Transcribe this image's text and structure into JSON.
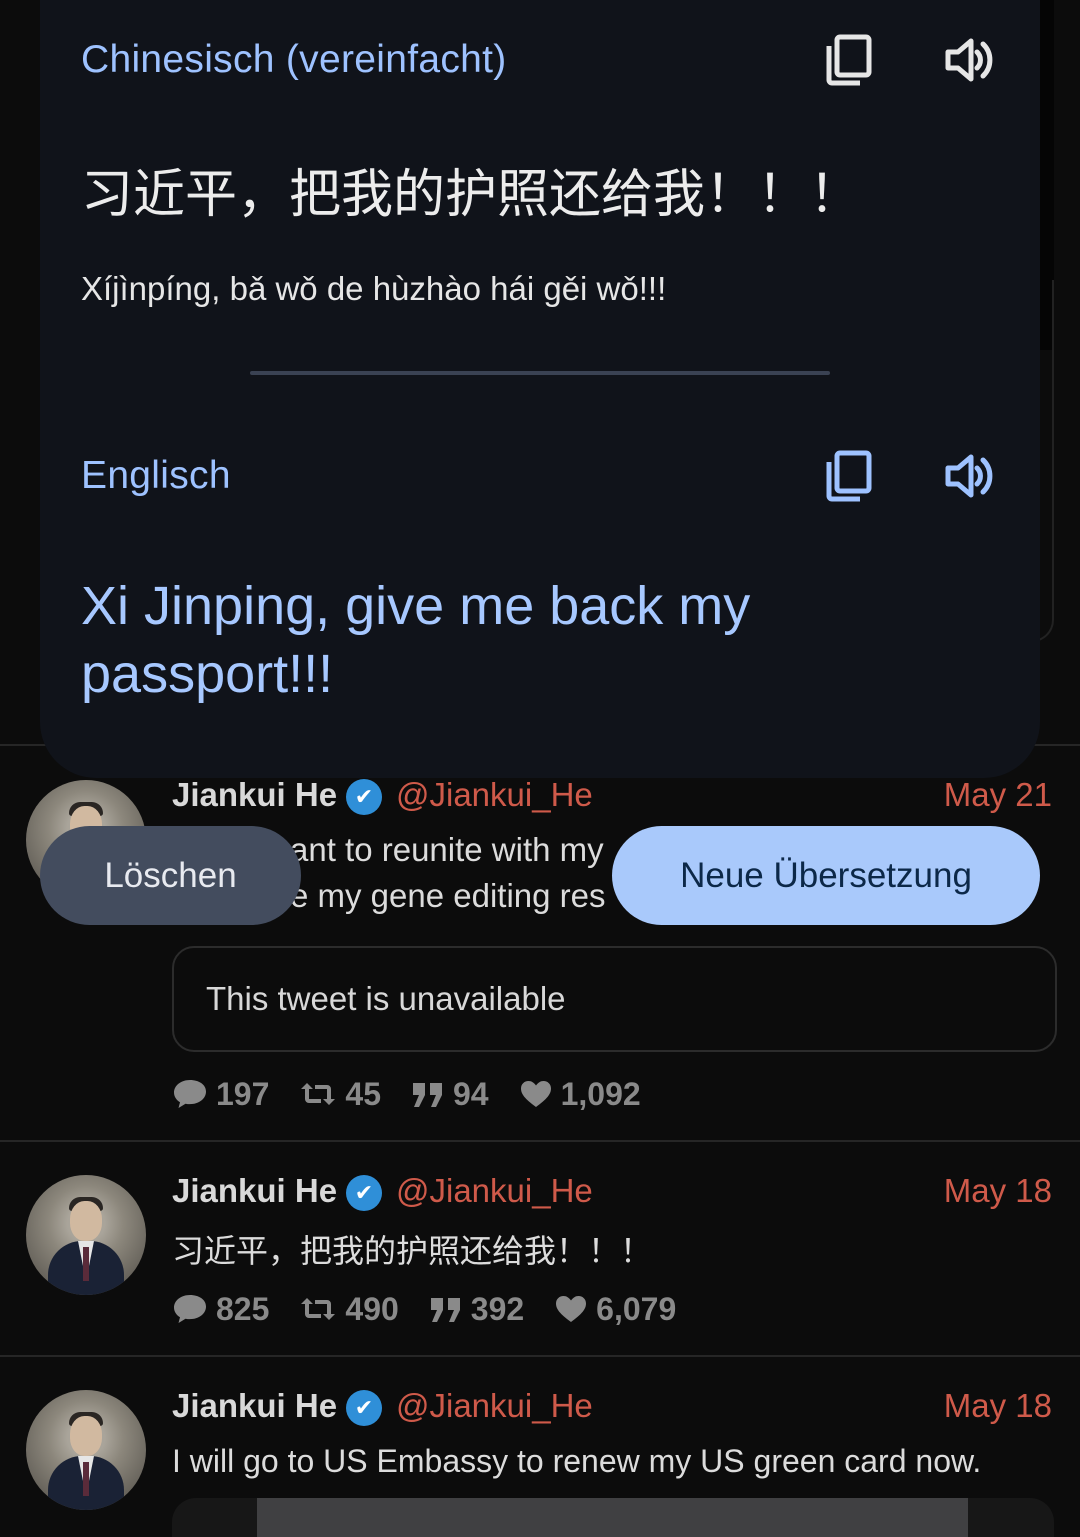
{
  "translation": {
    "source_lang": "Chinesisch (vereinfacht)",
    "source_text": "习近平，把我的护照还给我！！！",
    "pinyin": "Xíjìnpíng, bǎ wǒ de hùzhào hái gěi wǒ!!!",
    "target_lang": "Englisch",
    "target_text": "Xi Jinping, give me back my passport!!!",
    "icons": [
      "copy-icon",
      "speaker-icon"
    ]
  },
  "actions": {
    "delete_label": "Löschen",
    "new_translation_label": "Neue Übersetzung"
  },
  "tweets": [
    {
      "name": "Jiankui He",
      "handle": "@Jiankui_He",
      "date": "May 21",
      "text_line1": "ant to reunite with my",
      "text_line2": "e my gene editing res",
      "quoted": "This tweet is unavailable",
      "replies": "197",
      "retweets": "45",
      "quotes": "94",
      "likes": "1,092"
    },
    {
      "name": "Jiankui He",
      "handle": "@Jiankui_He",
      "date": "May 18",
      "text": "习近平，把我的护照还给我！！！",
      "replies": "825",
      "retweets": "490",
      "quotes": "392",
      "likes": "6,079"
    },
    {
      "name": "Jiankui He",
      "handle": "@Jiankui_He",
      "date": "May 18",
      "text": "I will go to US Embassy to renew my US green card now."
    }
  ],
  "colors": {
    "background": "#0c0c0c",
    "popup": "#10131a",
    "accent_blue": "#9ec2ff",
    "handle_red": "#cf5a4a",
    "verified": "#2f8fd8",
    "primary_button": "#a9c9fb",
    "secondary_button": "#434c5e"
  }
}
